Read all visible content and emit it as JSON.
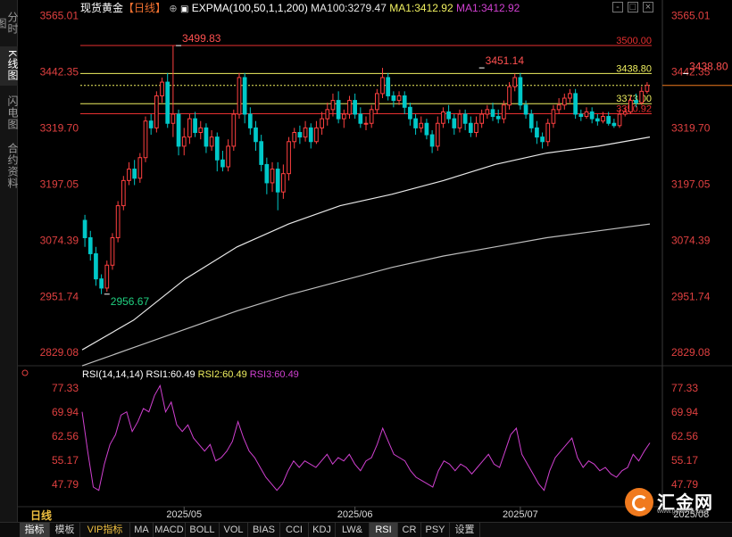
{
  "left_tabs": [
    {
      "label": "分时图",
      "active": false
    },
    {
      "label": "K线图",
      "active": true
    },
    {
      "label": "闪电图",
      "active": false
    },
    {
      "label": "合约资料",
      "active": false
    }
  ],
  "legend": {
    "symbol": "现货黄金",
    "period_tag": "【日线】",
    "indicator": "EXPMA(100,50,1,1,200)",
    "ma100": "MA100:3279.47",
    "ma1": "MA1:3412.92",
    "ma1b": "MA1:3412.92"
  },
  "rsi_legend": {
    "name": "RSI(14,14,14)",
    "rsi1": "RSI1:60.49",
    "rsi2": "RSI2:60.49",
    "rsi3": "RSI3:60.49"
  },
  "period_label": "日线",
  "bottom_tabs": [
    {
      "label": "指标",
      "active": true,
      "vip": false
    },
    {
      "label": "模板",
      "active": false,
      "vip": false
    },
    {
      "label": "VIP指标",
      "active": false,
      "vip": true
    },
    {
      "label": "MA",
      "active": false,
      "vip": false
    },
    {
      "label": "MACD",
      "active": false,
      "vip": false
    },
    {
      "label": "BOLL",
      "active": false,
      "vip": false
    },
    {
      "label": "VOL",
      "active": false,
      "vip": false
    },
    {
      "label": "BIAS",
      "active": false,
      "vip": false
    },
    {
      "label": "CCI",
      "active": false,
      "vip": false
    },
    {
      "label": "KDJ",
      "active": false,
      "vip": false
    },
    {
      "label": "LW&",
      "active": false,
      "vip": false
    },
    {
      "label": "RSI",
      "active": true,
      "vip": false
    },
    {
      "label": "CR",
      "active": false,
      "vip": false
    },
    {
      "label": "PSY",
      "active": false,
      "vip": false
    },
    {
      "label": "设置",
      "active": false,
      "vip": false
    }
  ],
  "logo": {
    "text": "汇金网",
    "url": "www.gold678.com"
  },
  "colors": {
    "up": "#ff4040",
    "down": "#00c8c8",
    "ma_white": "#e8e8e8",
    "ma_gray": "#bdbdbd",
    "yellow": "#f0f060",
    "red_line": "#e83030",
    "axis_text": "#e04040",
    "rsi": "#d040d0",
    "grid": "#5a1a1a"
  },
  "chart_data": {
    "type": "candlestick",
    "main_axis": {
      "ticks": [
        3565.01,
        3442.35,
        3319.7,
        3197.05,
        3074.39,
        2951.74,
        2829.08
      ],
      "tick_labels": [
        "3565.01",
        "3442.35",
        "3319.70",
        "3197.05",
        "3074.39",
        "2951.74",
        "2829.08"
      ],
      "range": [
        2810,
        3580
      ]
    },
    "rsi_axis": {
      "ticks": [
        77.33,
        69.94,
        62.56,
        55.17,
        47.79
      ],
      "tick_labels": [
        "77.33",
        "69.94",
        "62.56",
        "55.17",
        "47.79"
      ],
      "range": [
        41,
        80
      ]
    },
    "x_labels": [
      "2025/05",
      "2025/06",
      "2025/07",
      "2025/08"
    ],
    "x_label_index": [
      18,
      49,
      79,
      110
    ],
    "hlines": [
      {
        "value": 3500.0,
        "label": "3500.00",
        "color": "red"
      },
      {
        "value": 3438.8,
        "label": "3438.80",
        "color": "yellow"
      },
      {
        "value": 3412.92,
        "label": "",
        "color": "yellow_dotted"
      },
      {
        "value": 3373.0,
        "label": "3373.00",
        "color": "yellow"
      },
      {
        "value": 3350.92,
        "label": "3350.92",
        "color": "red"
      }
    ],
    "annotations": [
      {
        "text": "3499.83",
        "value": 3499.83,
        "index": 17,
        "color": "red"
      },
      {
        "text": "3451.14",
        "value": 3451.14,
        "index": 72,
        "color": "red"
      },
      {
        "text": "3438.80",
        "value": 3438.8,
        "index": 109,
        "color": "red"
      },
      {
        "text": "2956.67",
        "value": 2956.67,
        "index": 4,
        "color": "green"
      }
    ],
    "candles": [
      [
        3118,
        3080,
        3130,
        3060
      ],
      [
        3080,
        3045,
        3095,
        3030
      ],
      [
        3045,
        2990,
        3060,
        2975
      ],
      [
        2990,
        2970,
        3000,
        2956.67
      ],
      [
        2970,
        3020,
        3030,
        2962
      ],
      [
        3020,
        3080,
        3090,
        3010
      ],
      [
        3080,
        3150,
        3160,
        3070
      ],
      [
        3150,
        3205,
        3215,
        3140
      ],
      [
        3205,
        3230,
        3245,
        3195
      ],
      [
        3230,
        3210,
        3250,
        3195
      ],
      [
        3210,
        3255,
        3265,
        3200
      ],
      [
        3255,
        3335,
        3345,
        3245
      ],
      [
        3335,
        3320,
        3350,
        3305
      ],
      [
        3320,
        3390,
        3400,
        3310
      ],
      [
        3390,
        3420,
        3430,
        3375
      ],
      [
        3420,
        3330,
        3440,
        3320
      ],
      [
        3330,
        3350,
        3499.83,
        3300
      ],
      [
        3350,
        3280,
        3360,
        3260
      ],
      [
        3280,
        3300,
        3320,
        3260
      ],
      [
        3300,
        3340,
        3350,
        3285
      ],
      [
        3340,
        3310,
        3355,
        3300
      ],
      [
        3310,
        3320,
        3335,
        3295
      ],
      [
        3320,
        3280,
        3330,
        3265
      ],
      [
        3280,
        3300,
        3315,
        3270
      ],
      [
        3300,
        3250,
        3310,
        3225
      ],
      [
        3250,
        3235,
        3270,
        3225
      ],
      [
        3235,
        3280,
        3295,
        3225
      ],
      [
        3280,
        3350,
        3360,
        3270
      ],
      [
        3350,
        3430,
        3440,
        3340
      ],
      [
        3430,
        3350,
        3440,
        3330
      ],
      [
        3350,
        3320,
        3365,
        3305
      ],
      [
        3320,
        3290,
        3335,
        3270
      ],
      [
        3290,
        3240,
        3305,
        3225
      ],
      [
        3240,
        3200,
        3255,
        3175
      ],
      [
        3200,
        3230,
        3245,
        3180
      ],
      [
        3230,
        3180,
        3245,
        3140
      ],
      [
        3180,
        3220,
        3240,
        3165
      ],
      [
        3220,
        3290,
        3300,
        3205
      ],
      [
        3290,
        3310,
        3320,
        3275
      ],
      [
        3310,
        3300,
        3325,
        3285
      ],
      [
        3300,
        3320,
        3335,
        3290
      ],
      [
        3320,
        3290,
        3330,
        3275
      ],
      [
        3290,
        3320,
        3335,
        3285
      ],
      [
        3320,
        3340,
        3355,
        3305
      ],
      [
        3340,
        3360,
        3375,
        3325
      ],
      [
        3360,
        3380,
        3395,
        3345
      ],
      [
        3380,
        3340,
        3400,
        3330
      ],
      [
        3340,
        3350,
        3360,
        3320
      ],
      [
        3350,
        3380,
        3390,
        3340
      ],
      [
        3380,
        3350,
        3395,
        3340
      ],
      [
        3350,
        3330,
        3365,
        3320
      ],
      [
        3330,
        3330,
        3345,
        3315
      ],
      [
        3330,
        3360,
        3370,
        3320
      ],
      [
        3360,
        3395,
        3405,
        3350
      ],
      [
        3395,
        3430,
        3451.14,
        3385
      ],
      [
        3430,
        3390,
        3440,
        3380
      ],
      [
        3390,
        3380,
        3400,
        3365
      ],
      [
        3380,
        3390,
        3400,
        3370
      ],
      [
        3390,
        3365,
        3400,
        3350
      ],
      [
        3365,
        3340,
        3375,
        3325
      ],
      [
        3340,
        3320,
        3350,
        3305
      ],
      [
        3320,
        3330,
        3345,
        3310
      ],
      [
        3330,
        3305,
        3340,
        3295
      ],
      [
        3305,
        3280,
        3315,
        3265
      ],
      [
        3280,
        3330,
        3345,
        3270
      ],
      [
        3330,
        3355,
        3365,
        3320
      ],
      [
        3355,
        3340,
        3370,
        3330
      ],
      [
        3340,
        3320,
        3350,
        3305
      ],
      [
        3320,
        3350,
        3360,
        3310
      ],
      [
        3350,
        3330,
        3360,
        3315
      ],
      [
        3330,
        3310,
        3345,
        3300
      ],
      [
        3310,
        3330,
        3345,
        3300
      ],
      [
        3330,
        3350,
        3360,
        3320
      ],
      [
        3350,
        3360,
        3370,
        3340
      ],
      [
        3360,
        3345,
        3375,
        3335
      ],
      [
        3345,
        3340,
        3360,
        3330
      ],
      [
        3340,
        3370,
        3380,
        3330
      ],
      [
        3370,
        3410,
        3420,
        3360
      ],
      [
        3410,
        3430,
        3438.8,
        3400
      ],
      [
        3430,
        3370,
        3440,
        3360
      ],
      [
        3370,
        3350,
        3380,
        3340
      ],
      [
        3350,
        3320,
        3360,
        3310
      ],
      [
        3320,
        3300,
        3335,
        3285
      ],
      [
        3300,
        3290,
        3310,
        3275
      ],
      [
        3290,
        3330,
        3340,
        3280
      ],
      [
        3330,
        3360,
        3370,
        3320
      ],
      [
        3360,
        3370,
        3385,
        3350
      ],
      [
        3370,
        3385,
        3395,
        3360
      ],
      [
        3385,
        3395,
        3405,
        3375
      ],
      [
        3395,
        3350,
        3405,
        3340
      ],
      [
        3350,
        3345,
        3360,
        3335
      ],
      [
        3345,
        3355,
        3365,
        3340
      ],
      [
        3355,
        3340,
        3365,
        3330
      ],
      [
        3340,
        3335,
        3350,
        3325
      ],
      [
        3335,
        3345,
        3355,
        3330
      ],
      [
        3345,
        3330,
        3355,
        3325
      ],
      [
        3330,
        3325,
        3340,
        3320
      ],
      [
        3325,
        3350,
        3360,
        3320
      ],
      [
        3350,
        3355,
        3365,
        3345
      ],
      [
        3355,
        3380,
        3390,
        3350
      ],
      [
        3380,
        3375,
        3395,
        3365
      ],
      [
        3375,
        3400,
        3410,
        3370
      ],
      [
        3400,
        3412.92,
        3420,
        3395
      ]
    ],
    "ma_white": [
      [
        0,
        2835
      ],
      [
        20,
        2900
      ],
      [
        40,
        2990
      ],
      [
        60,
        3060
      ],
      [
        80,
        3110
      ],
      [
        100,
        3150
      ],
      [
        120,
        3175
      ],
      [
        140,
        3205
      ],
      [
        160,
        3240
      ],
      [
        180,
        3265
      ],
      [
        200,
        3280
      ],
      [
        220,
        3300
      ]
    ],
    "ma_gray": [
      [
        0,
        2800
      ],
      [
        20,
        2840
      ],
      [
        40,
        2880
      ],
      [
        60,
        2920
      ],
      [
        80,
        2955
      ],
      [
        100,
        2985
      ],
      [
        120,
        3015
      ],
      [
        140,
        3040
      ],
      [
        160,
        3060
      ],
      [
        180,
        3080
      ],
      [
        200,
        3095
      ],
      [
        220,
        3110
      ]
    ],
    "rsi": [
      70,
      58,
      47,
      46,
      54,
      60,
      63,
      69,
      70,
      64,
      67,
      71,
      70,
      75,
      78,
      70,
      73,
      66,
      64,
      66,
      62,
      60,
      58,
      60,
      55,
      56,
      58,
      61,
      67,
      62,
      58,
      56,
      53,
      50,
      48,
      46,
      48,
      52,
      55,
      53,
      55,
      54,
      53,
      55,
      57,
      54,
      56,
      55,
      57,
      54,
      52,
      55,
      56,
      60,
      65,
      61,
      57,
      56,
      55,
      52,
      50,
      49,
      48,
      47,
      52,
      55,
      54,
      52,
      54,
      53,
      51,
      53,
      55,
      57,
      54,
      53,
      58,
      63,
      65,
      57,
      54,
      51,
      48,
      46,
      52,
      56,
      58,
      60,
      62,
      56,
      53,
      55,
      54,
      52,
      53,
      51,
      50,
      52,
      53,
      57,
      55,
      58,
      60.49
    ]
  }
}
